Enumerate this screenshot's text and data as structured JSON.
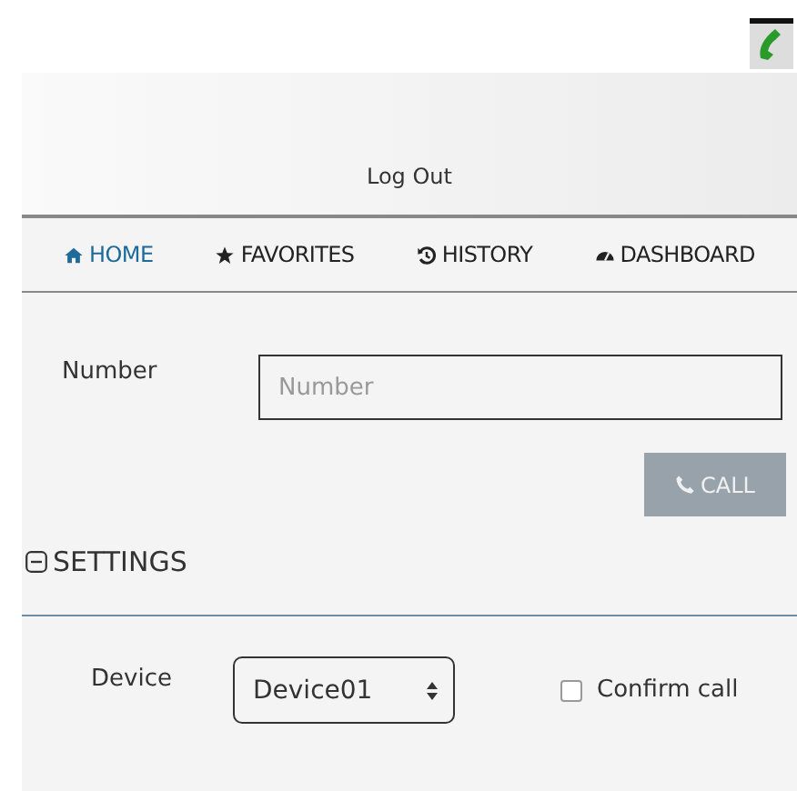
{
  "header": {
    "logout": "Log Out"
  },
  "nav": [
    {
      "label": "HOME",
      "selected": true
    },
    {
      "label": "FAVORITES",
      "selected": false
    },
    {
      "label": "HISTORY",
      "selected": false
    },
    {
      "label": "DASHBOARD",
      "selected": false
    }
  ],
  "number": {
    "label": "Number",
    "placeholder": "Number"
  },
  "call_button": "CALL",
  "settings": {
    "title": "SETTINGS",
    "expanded": true,
    "device_label": "Device",
    "device_value": "Device01",
    "confirm_label": "Confirm call",
    "confirm_checked": false
  }
}
